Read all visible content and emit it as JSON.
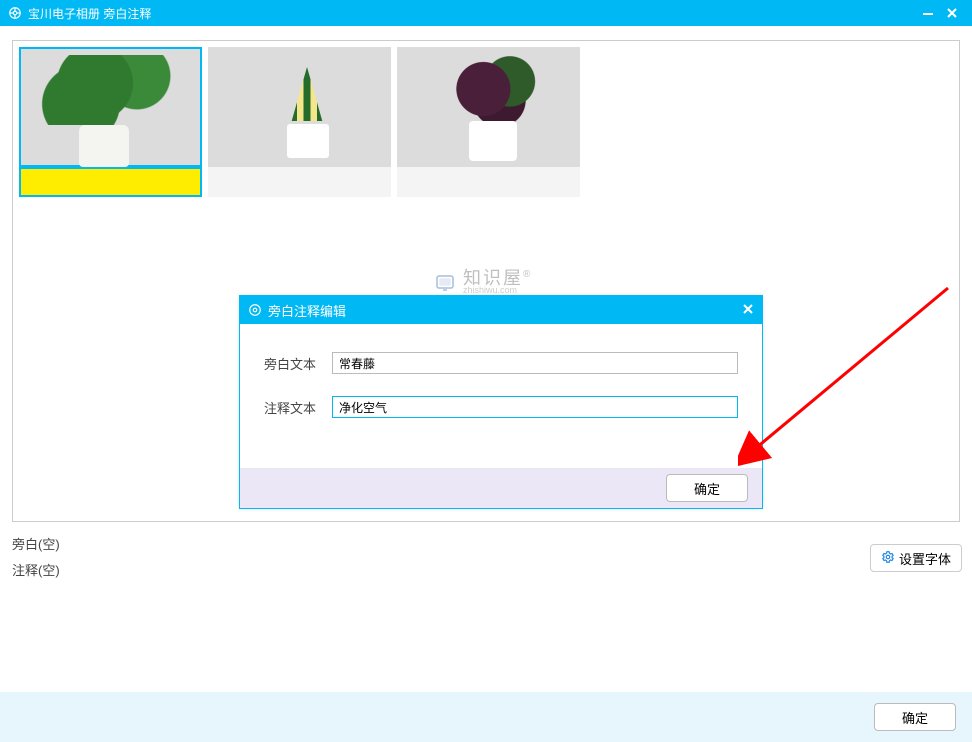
{
  "header": {
    "title": "宝川电子相册  旁白注释"
  },
  "thumbs": [
    "plant1",
    "plant2",
    "plant3"
  ],
  "info": {
    "aside_label": "旁白(空)",
    "annot_label": "注释(空)",
    "font_btn": "设置字体"
  },
  "modal": {
    "title": "旁白注释编辑",
    "row1_label": "旁白文本",
    "row1_value": "常春藤",
    "row2_label": "注释文本",
    "row2_value": "净化空气",
    "ok": "确定"
  },
  "footer": {
    "ok": "确定"
  },
  "watermark": {
    "cn": "知识屋",
    "en": "zhishiwu.com",
    "sup": "®"
  }
}
